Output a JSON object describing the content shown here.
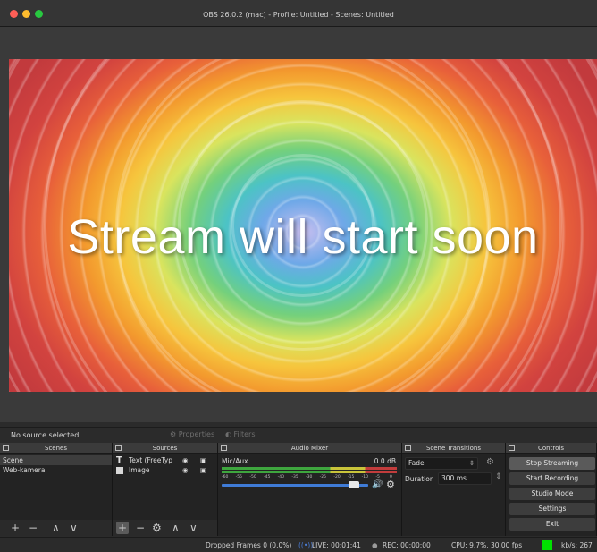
{
  "window": {
    "title": "OBS 26.0.2 (mac) - Profile: Untitled - Scenes: Untitled"
  },
  "preview": {
    "overlay_text": "Stream will start soon"
  },
  "source_toolbar": {
    "status": "No source selected",
    "properties_label": "Properties",
    "filters_label": "Filters"
  },
  "scenes": {
    "header": "Scenes",
    "items": [
      {
        "label": "Scene",
        "selected": true
      },
      {
        "label": "Web-kamera",
        "selected": false
      }
    ],
    "footer": [
      "+",
      "−",
      "∧",
      "∨"
    ]
  },
  "sources": {
    "header": "Sources",
    "items": [
      {
        "label": "Text (FreeTyp",
        "icon": "text-source-icon"
      },
      {
        "label": "Image",
        "icon": "image-source-icon"
      }
    ],
    "footer": [
      "+",
      "−",
      "⚙",
      "∧",
      "∨"
    ]
  },
  "mixer": {
    "header": "Audio Mixer",
    "channel": "Mic/Aux",
    "level": "0.0 dB",
    "scale": [
      "-60",
      "-55",
      "-50",
      "-45",
      "-40",
      "-35",
      "-30",
      "-25",
      "-20",
      "-15",
      "-10",
      "-5",
      "0"
    ],
    "volume": 0.94
  },
  "transitions": {
    "header": "Scene Transitions",
    "selected": "Fade",
    "duration_label": "Duration",
    "duration_value": "300 ms"
  },
  "controls": {
    "header": "Controls",
    "buttons": [
      "Stop Streaming",
      "Start Recording",
      "Studio Mode",
      "Settings",
      "Exit"
    ]
  },
  "status": {
    "dropped": "Dropped Frames 0 (0.0%)",
    "live": "LIVE: 00:01:41",
    "rec": "REC: 00:00:00",
    "cpu": "CPU: 9.7%, 30.00 fps",
    "kbps": "kb/s: 267",
    "health_color": "#00e000"
  },
  "colors": {
    "traffic_close": "#fe5f57",
    "traffic_min": "#febc2e",
    "traffic_max": "#28c840"
  }
}
